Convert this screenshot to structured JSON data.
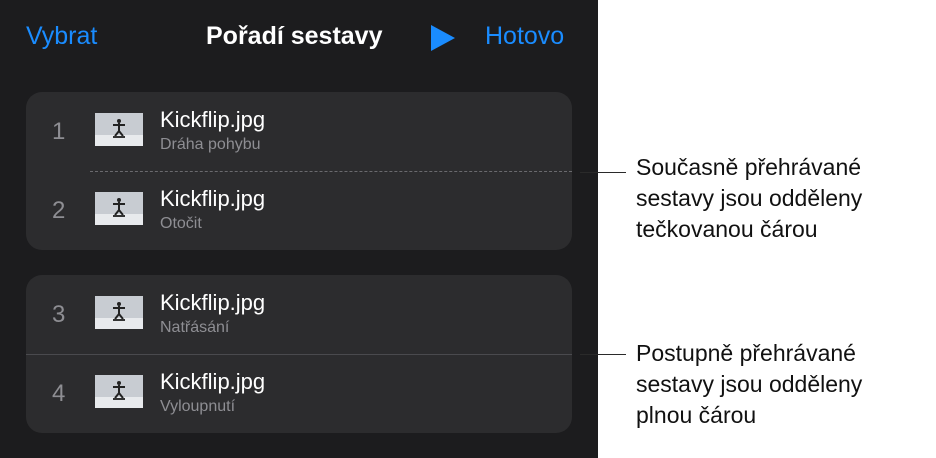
{
  "toolbar": {
    "select_label": "Vybrat",
    "title": "Pořadí sestavy",
    "play_icon": "play-icon",
    "done_label": "Hotovo"
  },
  "accent_color": "#1a8cff",
  "groups": [
    {
      "separator": "dotted",
      "items": [
        {
          "number": "1",
          "name": "Kickflip.jpg",
          "subtitle": "Dráha pohybu"
        },
        {
          "number": "2",
          "name": "Kickflip.jpg",
          "subtitle": "Otočit"
        }
      ]
    },
    {
      "separator": "solid",
      "items": [
        {
          "number": "3",
          "name": "Kickflip.jpg",
          "subtitle": "Natřásání"
        },
        {
          "number": "4",
          "name": "Kickflip.jpg",
          "subtitle": "Vyloupnutí"
        }
      ]
    }
  ],
  "callouts": [
    {
      "lines": [
        "Současně přehrávané",
        "sestavy jsou odděleny",
        "tečkovanou čárou"
      ]
    },
    {
      "lines": [
        "Postupně přehrávané",
        "sestavy jsou odděleny",
        "plnou čárou"
      ]
    }
  ]
}
